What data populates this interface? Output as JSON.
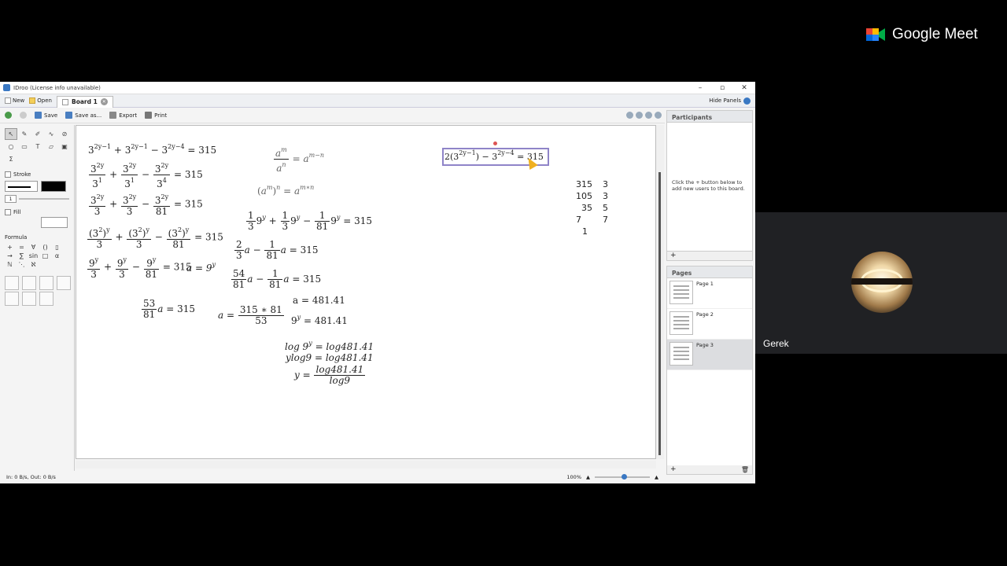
{
  "meet": {
    "brand": "Google Meet",
    "participant_name": "Gerek"
  },
  "app": {
    "window_title": "IDroo (License info unavailable)",
    "tabbar": {
      "new": "New",
      "open": "Open",
      "board_tab": "Board 1",
      "hide_panels": "Hide Panels"
    },
    "toolbar": {
      "save": "Save",
      "save_as": "Save as...",
      "export": "Export",
      "print": "Print"
    },
    "left": {
      "stroke": "Stroke",
      "stroke_width": "1",
      "fill": "Fill",
      "formula": "Formula"
    },
    "status": {
      "io": "In: 0 B/s, Out: 0 B/s",
      "zoom": "100%"
    },
    "participants": {
      "header": "Participants",
      "hint": "Click the + button below to add new users to this board.",
      "add": "+"
    },
    "pages": {
      "header": "Pages",
      "items": [
        "Page 1",
        "Page 2",
        "Page 3"
      ],
      "add": "+"
    }
  },
  "board": {
    "left_eq": {
      "l1": "3",
      "l1_e1": "2y−1",
      "l1_b": "+ 3",
      "l1_e2": "2y−1",
      "l1_c": "− 3",
      "l1_e3": "2y−4",
      "l1_r": "= 315",
      "rhs": "= 315",
      "a_eq": "a = 9"
    },
    "sel_eq": {
      "prefix": "2(3",
      "e1": "2y−1",
      "mid": ") − 3",
      "e2": "2y−4",
      "rhs": "= 315"
    },
    "solve": {
      "a_val": "a = 481.41",
      "nine_y": "9",
      "nine_y_val": "= 481.41",
      "log1_l": "log 9",
      "log1_r": "= log481.41",
      "log2": "ylog9 = log481.41",
      "y_eq": "y =",
      "num": "log481.41",
      "den": "log9"
    },
    "division": [
      [
        "315",
        "3"
      ],
      [
        "105",
        "3"
      ],
      [
        "35",
        "5"
      ],
      [
        "7",
        "7"
      ],
      [
        "1",
        ""
      ]
    ]
  }
}
